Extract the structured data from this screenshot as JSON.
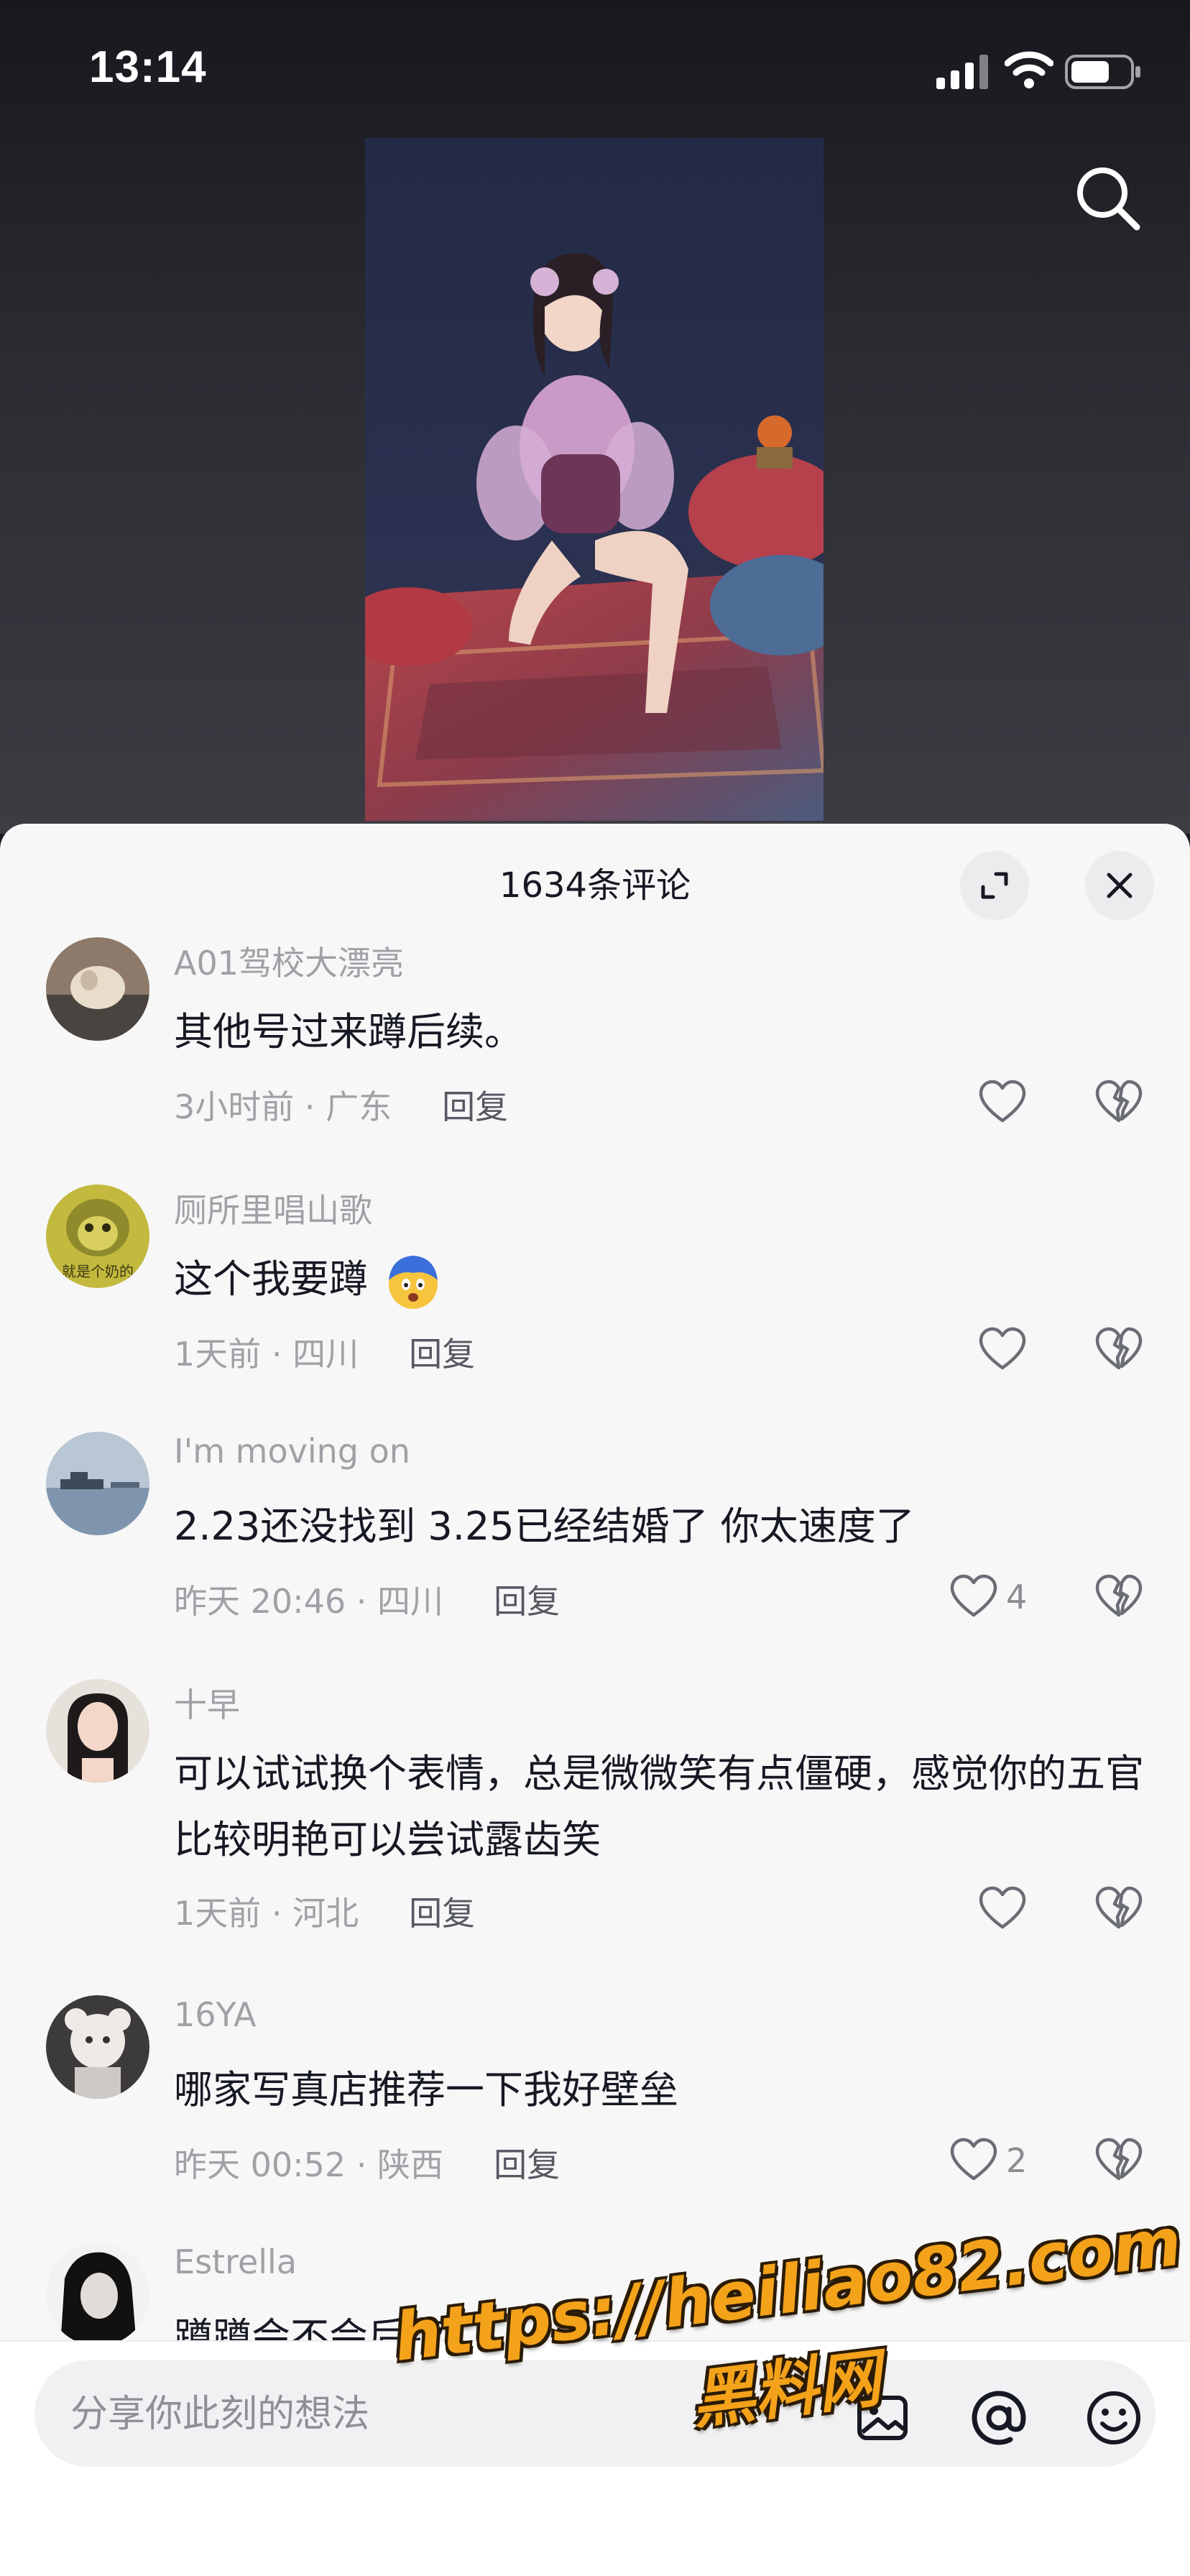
{
  "status_bar": {
    "time": "13:14"
  },
  "comments_panel": {
    "title": "1634条评论"
  },
  "comments": [
    {
      "username": "A01驾校大漂亮",
      "text": "其他号过来蹲后续。",
      "meta": "3小时前 · 广东",
      "reply_label": "回复",
      "likes": ""
    },
    {
      "username": "厕所里唱山歌",
      "text": "这个我要蹲",
      "meta": "1天前 · 四川",
      "reply_label": "回复",
      "likes": ""
    },
    {
      "username": "I'm moving on",
      "text": "2.23还没找到 3.25已经结婚了 你太速度了",
      "meta": "昨天 20:46 · 四川",
      "reply_label": "回复",
      "likes": "4"
    },
    {
      "username": "十早",
      "text": "可以试试换个表情，总是微微笑有点僵硬，感觉你的五官比较明艳可以尝试露齿笑",
      "meta": "1天前 · 河北",
      "reply_label": "回复",
      "likes": ""
    },
    {
      "username": "16YA",
      "text": "哪家写真店推荐一下我好壁垒",
      "meta": "昨天 00:52 · 陕西",
      "reply_label": "回复",
      "likes": "2"
    },
    {
      "username": "Estrella",
      "text": "蹲蹲会不会后续",
      "meta": "",
      "reply_label": "",
      "likes": ""
    }
  ],
  "avatar_2_caption": "就是个奶的",
  "input": {
    "placeholder": "分享你此刻的想法"
  },
  "watermark": {
    "line1": "https://heiliao82.com",
    "line2": "黑料网"
  },
  "icons": {
    "search": "search-icon",
    "expand": "expand-icon",
    "close": "close-icon",
    "like": "heart-icon",
    "dislike": "broken-heart-icon",
    "image": "image-icon",
    "mention": "at-icon",
    "emoji": "emoji-icon"
  },
  "colors": {
    "sheet_bg": "#f7f7f7",
    "primary_text": "#161823",
    "secondary_text": "#a0a1a7",
    "watermark": "#f3a21a"
  }
}
